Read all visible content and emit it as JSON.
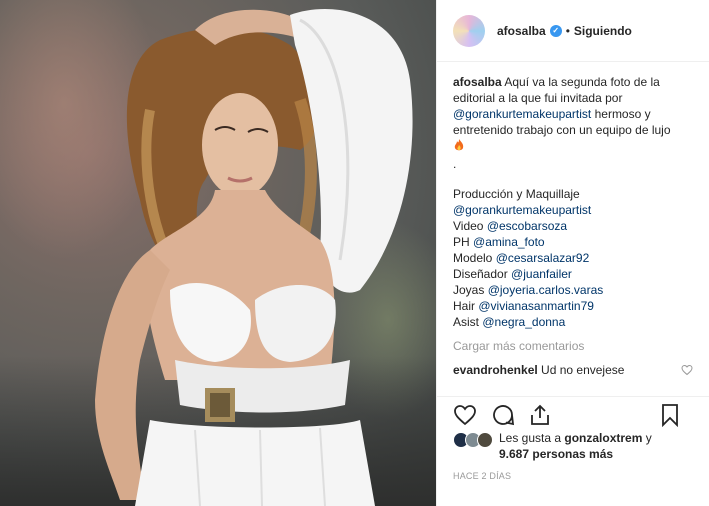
{
  "post": {
    "username": "afosalba",
    "verified_mark": "✓",
    "separator": "•",
    "follow_state": "Siguiendo",
    "caption": {
      "user": "afosalba",
      "text1": "Aquí va la segunda foto de la editorial a la que fui invitada por",
      "mention1": "@gorankurtemakeupartist",
      "text2": "hermoso y entretenido trabajo con un equipo de lujo",
      "dot": "."
    },
    "credits": [
      {
        "label": "Producción y Maquillaje",
        "mention": ""
      },
      {
        "label": "",
        "mention": "@gorankurtemakeupartist"
      },
      {
        "label": "Video",
        "mention": "@escobarsoza"
      },
      {
        "label": "PH",
        "mention": "@amina_foto"
      },
      {
        "label": "Modelo",
        "mention": "@cesarsalazar92"
      },
      {
        "label": "Diseñador",
        "mention": "@juanfailer"
      },
      {
        "label": "Joyas",
        "mention": "@joyeria.carlos.varas"
      },
      {
        "label": "Hair",
        "mention": "@vivianasanmartin79"
      },
      {
        "label": "Asist",
        "mention": "@negra_donna"
      }
    ],
    "load_more": "Cargar más comentarios",
    "comments": [
      {
        "user": "evandrohenkel",
        "text": "Ud no envejese"
      }
    ],
    "likes": {
      "prefix": "Les gusta a",
      "liker": "gonzaloxtrem",
      "joiner": "y",
      "count": "9.687 personas más"
    },
    "time": "HACE 2 DÍAS"
  },
  "icons": {
    "like": "heart-icon",
    "comment": "comment-icon",
    "share": "share-icon",
    "save": "bookmark-icon"
  },
  "colors": {
    "link": "#003569",
    "muted": "#999999",
    "verified": "#3897f0",
    "text": "#262626"
  }
}
